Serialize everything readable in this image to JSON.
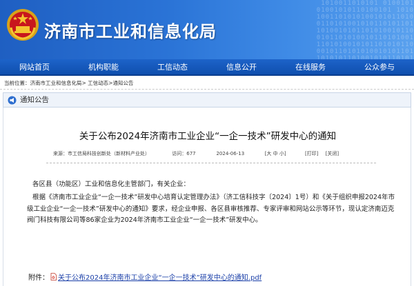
{
  "header": {
    "site_title": "济南市工业和信息化局",
    "binary_text": "1010011010101 0100101\n01001010110100101 1010\n1001101010100101011010\n0110101001010110101101\n1010010101101010010110\n0101101010010110101001\n1101010010101101010110\n0010110101010010101101\n1010101101001010110101"
  },
  "nav": {
    "items": [
      "网站首页",
      "机构职能",
      "工信动态",
      "信息公开",
      "在线服务",
      "公众参与"
    ]
  },
  "breadcrumb": {
    "prefix": "当前位置：",
    "home": "济南市工业和信息化局",
    "sep1": "> ",
    "section": "工信动态",
    "sep2": ">",
    "current": "通知公告"
  },
  "section": {
    "title": "通知公告"
  },
  "article": {
    "title": "关于公布2024年济南市工业企业“一企一技术”研发中心的通知",
    "source": "来源：市工信局科技创新处（新材料产业处）",
    "visits": "访问：677",
    "date": "2024-06-13",
    "font_size": "[大 中 小]",
    "print": "[打印]",
    "close": "[关闭]",
    "greeting": "各区县（功能区）工业和信息化主管部门，有关企业：",
    "paragraph": "根据《济南市工业企业“一企一技术”研发中心培育认定管理办法》（济工信科技字〔2024〕1号）和《关于组织申报2024年市级工业企业“一企一技术”研发中心的通知》要求，经企业申报、各区县审核推荐、专家评审和网站公示等环节，现认定济南迈克阀门科技有限公司等86家企业为2024年济南市工业企业“一企一技术”研发中心。",
    "attachment_label": "附件：",
    "attachment_link": "关于公布2024年济南市工业企业“一企一技术”研发中心的通知.pdf"
  },
  "colors": {
    "banner": "#2a73d6",
    "nav": "#1d63c9",
    "link": "#1a3fa8"
  }
}
